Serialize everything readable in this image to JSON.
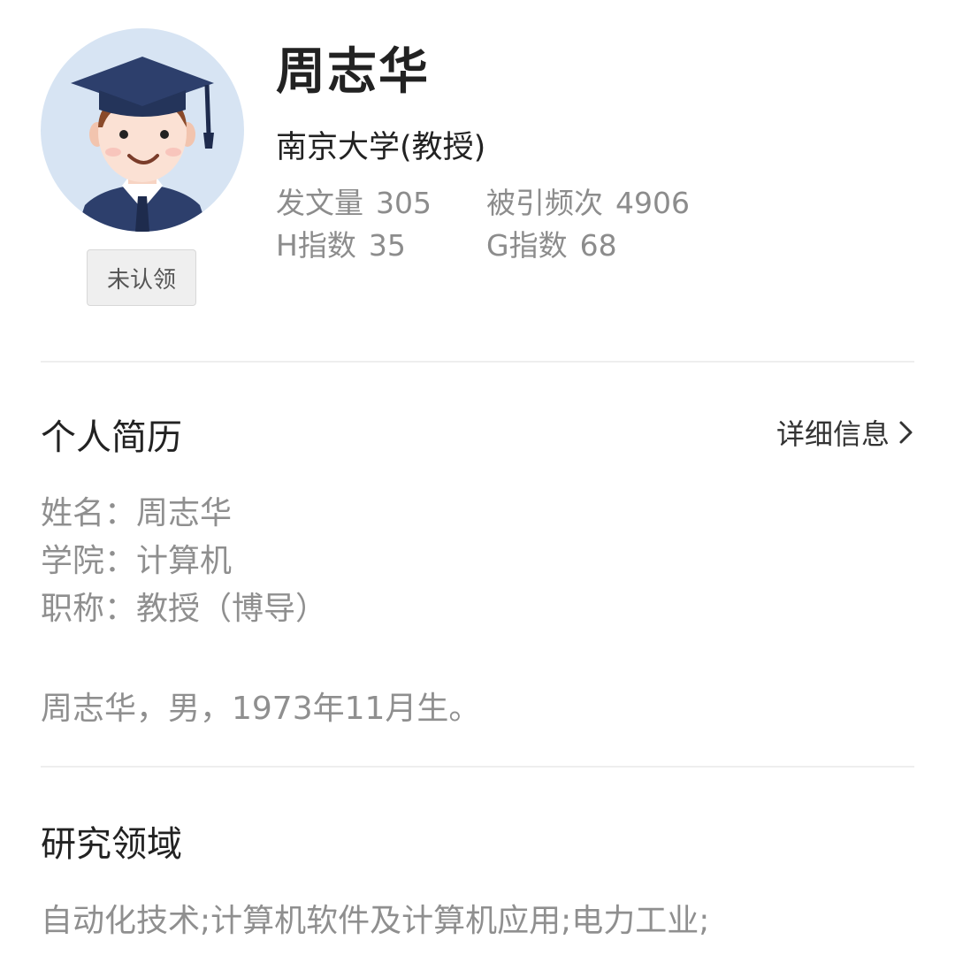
{
  "profile": {
    "name": "周志华",
    "institution": "南京大学(教授)",
    "claim_status": "未认领",
    "stats": [
      {
        "label": "发文量",
        "value": "305"
      },
      {
        "label": "被引频次",
        "value": "4906"
      },
      {
        "label": "H指数",
        "value": "35"
      },
      {
        "label": "G指数",
        "value": "68"
      }
    ]
  },
  "bio": {
    "title": "个人简历",
    "detail_link": "详细信息",
    "fields": [
      {
        "key": "姓名",
        "value": "周志华"
      },
      {
        "key": "学院",
        "value": "计算机"
      },
      {
        "key": "职称",
        "value": "教授（博导）"
      }
    ],
    "summary": "周志华，男，1973年11月生。"
  },
  "research": {
    "title": "研究领域",
    "text": "自动化技术;计算机软件及计算机应用;电力工业;"
  },
  "icons": {
    "avatar": "graduate-avatar-icon",
    "chevron": "chevron-right-icon"
  }
}
